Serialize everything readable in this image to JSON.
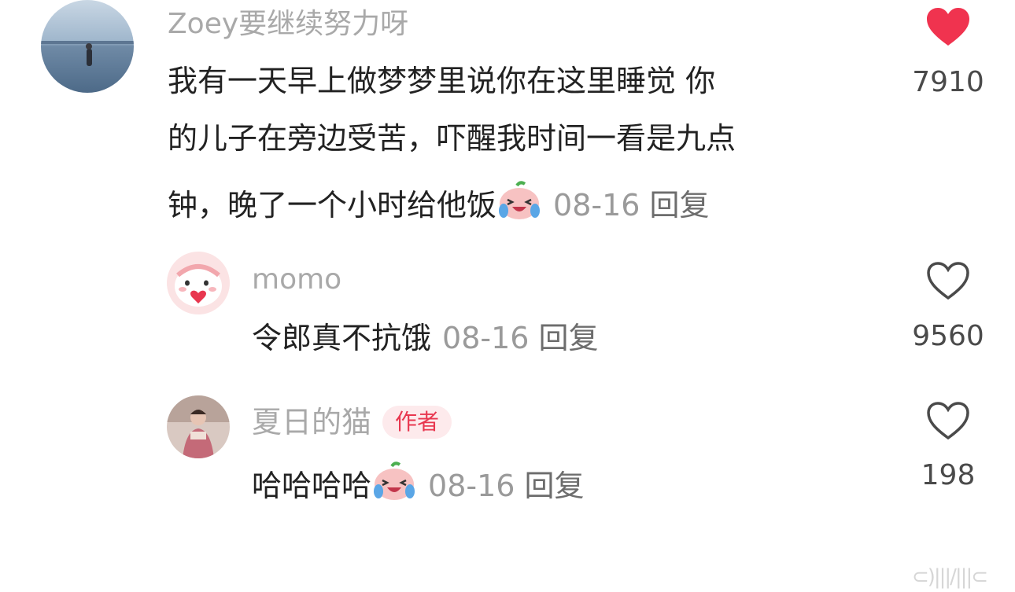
{
  "comments": [
    {
      "username": "Zoey要继续努力呀",
      "avatar": "ocean-photo-avatar",
      "lines": [
        "我有一天早上做梦梦里说你在这里睡觉 你",
        "的儿子在旁边受苦，吓醒我时间一看是九点",
        "钟，晚了一个小时给他饭"
      ],
      "emoji": "crying-laughing-peach-emoji",
      "date": "08-16",
      "reply_label": "回复",
      "liked": true,
      "likes": "7910"
    },
    {
      "username": "momo",
      "avatar": "pink-cartoon-avatar",
      "text": "令郎真不抗饿",
      "date": "08-16",
      "reply_label": "回复",
      "liked": false,
      "likes": "9560"
    },
    {
      "username": "夏日的猫",
      "badge": "作者",
      "avatar": "person-photo-avatar",
      "text": "哈哈哈哈",
      "emoji": "crying-laughing-peach-emoji",
      "date": "08-16",
      "reply_label": "回复",
      "liked": false,
      "likes": "198"
    }
  ],
  "colors": {
    "liked_heart": "#f0334f",
    "username": "#a9a9a9",
    "badge_text": "#e8374f",
    "badge_bg": "#fdeaec"
  },
  "watermark": "⊂)|||/|||⊂"
}
